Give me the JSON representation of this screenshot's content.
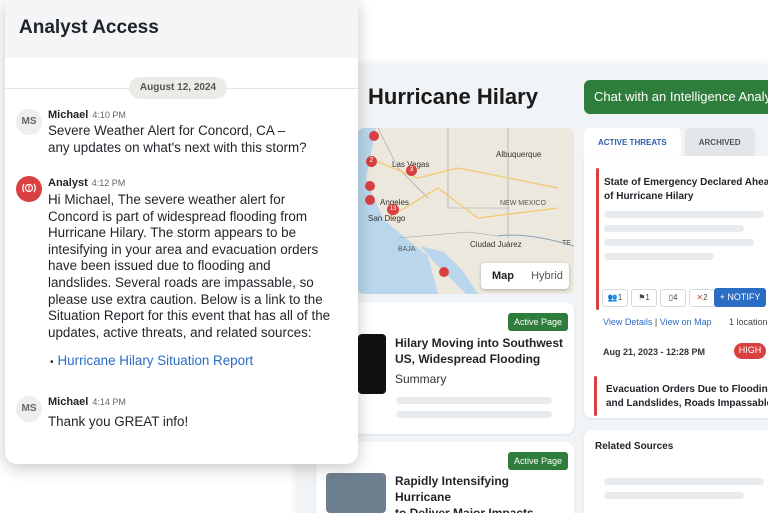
{
  "chat_panel": {
    "title": "Analyst Access",
    "date_divider": "August 12, 2024",
    "messages": [
      {
        "avatar_initials": "MS",
        "sender": "Michael",
        "time": "4:10 PM",
        "lines": [
          "Severe Weather Alert for Concord, CA –",
          "any updates on what's next with this storm?"
        ]
      },
      {
        "avatar_icon": "alert-broadcast-icon",
        "sender": "Analyst",
        "time": "4:12 PM",
        "lines": [
          "Hi Michael, The severe weather alert for",
          "Concord is part of widespread flooding from",
          "Hurricane Hilary. The storm appears to be",
          "intesifying in your area and evacuation orders",
          "have been issued due to flooding and",
          "landslides. Several roads are impassable, so",
          "please use extra caution. Below is a link to the",
          "Situation Report for this event that has all of the",
          "updates, active threats, and related sources:"
        ],
        "link_text": "Hurricane Hilary Situation Report"
      },
      {
        "avatar_initials": "MS",
        "sender": "Michael",
        "time": "4:14 PM",
        "lines": [
          "Thank you GREAT info!"
        ]
      }
    ]
  },
  "dashboard": {
    "title": "Hurricane Hilary",
    "chat_button": "Chat with an Intelligence Analyst",
    "map": {
      "labels": {
        "las_vegas": "Las Vegas",
        "albuquerque": "Albuquerque",
        "angeles": "Angeles",
        "san_diego": "San Diego",
        "new_mexico": "NEW MEXICO",
        "baja": "BAJA",
        "ciudad_juarez": "Ciudad Juárez",
        "texas": "TE"
      },
      "cluster_counts": [
        "2",
        "3",
        "13"
      ],
      "toggle": {
        "map": "Map",
        "hybrid": "Hybrid"
      }
    },
    "stories": [
      {
        "badge": "Active Page",
        "title_lines": [
          "Hilary Moving into Southwest",
          "US, Widespread Flooding"
        ],
        "subtitle": "Summary"
      },
      {
        "badge": "Active Page",
        "title_lines": [
          "Rapidly Intensifying Hurricane",
          "to Deliver Major Impacts"
        ]
      }
    ],
    "tabs": {
      "active": "ACTIVE THREATS",
      "archived": "ARCHIVED"
    },
    "threats": [
      {
        "title_lines": [
          "State of Emergency Declared Ahead",
          "of Hurricane Hilary"
        ],
        "counts": {
          "people": "1",
          "flag": "1",
          "device": "4",
          "route": "2"
        },
        "notify": "NOTIFY",
        "view_details": "View Details",
        "separator": "|",
        "view_on_map": "View on Map",
        "locations": "1 location",
        "date": "Aug 21, 2023 - 12:28 PM",
        "severity": "HIGH"
      },
      {
        "title_lines": [
          "Evacuation Orders Due to Flooding",
          "and Landslides,  Roads Impassable"
        ]
      }
    ],
    "related_sources": "Related Sources"
  },
  "colors": {
    "accent_green": "#2f7d3c",
    "link_blue": "#2b6cc4",
    "alert_red": "#d94040"
  }
}
